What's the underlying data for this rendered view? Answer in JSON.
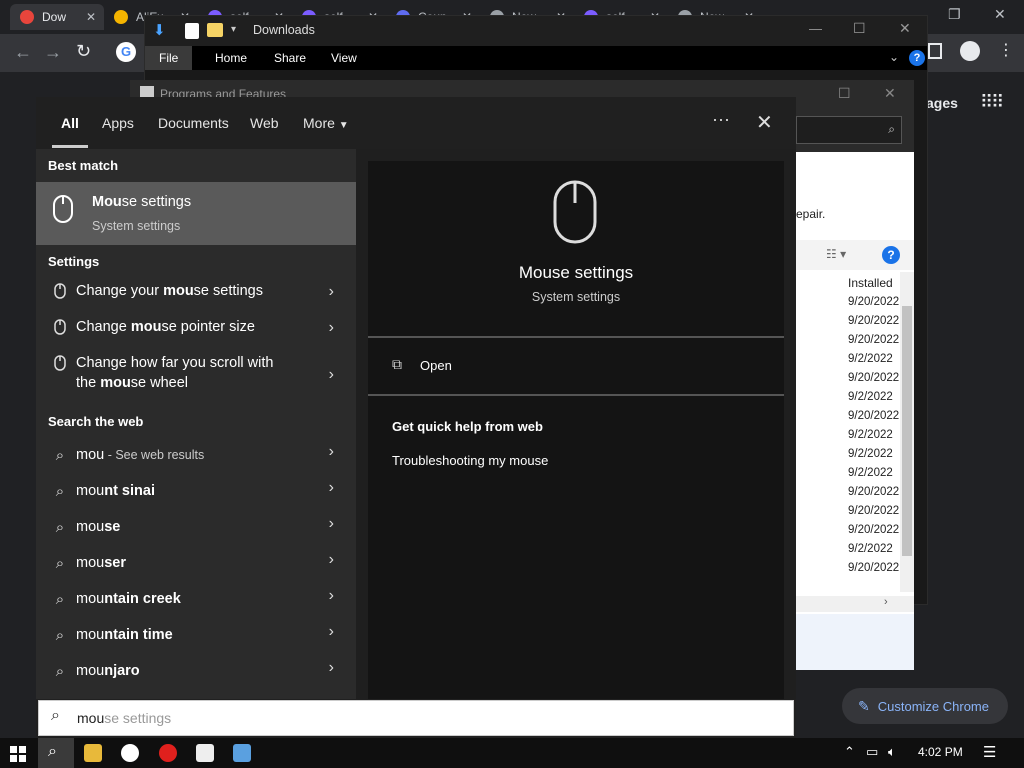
{
  "chrome": {
    "tabs": [
      {
        "label": "Dow",
        "color": "#e8453c"
      },
      {
        "label": "AliEx",
        "color": "#f5b400"
      },
      {
        "label": "self",
        "color": "#7b5cff"
      },
      {
        "label": "self",
        "color": "#7b5cff"
      },
      {
        "label": "Coun",
        "color": "#5f6cf0"
      },
      {
        "label": "New",
        "color": "#9aa0a6"
      },
      {
        "label": "self",
        "color": "#7b5cff"
      },
      {
        "label": "New",
        "color": "#9aa0a6"
      }
    ],
    "pages_label": "ages",
    "customize_label": "Customize Chrome"
  },
  "explorer": {
    "title": "Downloads",
    "ribbon": [
      "File",
      "Home",
      "Share",
      "View"
    ]
  },
  "programs": {
    "title": "Programs and Features",
    "repair_text": "epair.",
    "col_header": "Installed",
    "dates": [
      "9/20/2022",
      "9/20/2022",
      "9/20/2022",
      "9/2/2022",
      "9/20/2022",
      "9/2/2022",
      "9/20/2022",
      "9/2/2022",
      "9/2/2022",
      "9/2/2022",
      "9/20/2022",
      "9/20/2022",
      "9/20/2022",
      "9/2/2022",
      "9/20/2022"
    ]
  },
  "start": {
    "tabs": [
      "All",
      "Apps",
      "Documents",
      "Web",
      "More"
    ],
    "best_match_header": "Best match",
    "best_match": {
      "title_bold": "Mou",
      "title_rest": "se settings",
      "subtitle": "System settings"
    },
    "settings_header": "Settings",
    "settings": [
      {
        "pre": "Change your ",
        "bold": "mou",
        "post": "se settings",
        "line2_pre": "",
        "line2_bold": "",
        "line2_post": ""
      },
      {
        "pre": "Change ",
        "bold": "mou",
        "post": "se pointer size",
        "line2_pre": "",
        "line2_bold": "",
        "line2_post": ""
      },
      {
        "pre": "Change how far you scroll with",
        "bold": "",
        "post": "",
        "line2_pre": "the ",
        "line2_bold": "mou",
        "line2_post": "se wheel"
      }
    ],
    "web_header": "Search the web",
    "web": [
      {
        "pre": "mou",
        "bold": "",
        "extra": " - See web results"
      },
      {
        "pre": "mou",
        "bold": "nt sinai",
        "extra": ""
      },
      {
        "pre": "mou",
        "bold": "se",
        "extra": ""
      },
      {
        "pre": "mou",
        "bold": "ser",
        "extra": ""
      },
      {
        "pre": "mou",
        "bold": "ntain creek",
        "extra": ""
      },
      {
        "pre": "mou",
        "bold": "ntain time",
        "extra": ""
      },
      {
        "pre": "mou",
        "bold": "njaro",
        "extra": ""
      }
    ],
    "preview": {
      "title": "Mouse settings",
      "subtitle": "System settings",
      "open_label": "Open",
      "help_header": "Get quick help from web",
      "help_link": "Troubleshooting my mouse"
    },
    "search": {
      "typed": "mou",
      "suggestion": "se settings"
    }
  },
  "taskbar": {
    "time": "4:02 PM"
  }
}
